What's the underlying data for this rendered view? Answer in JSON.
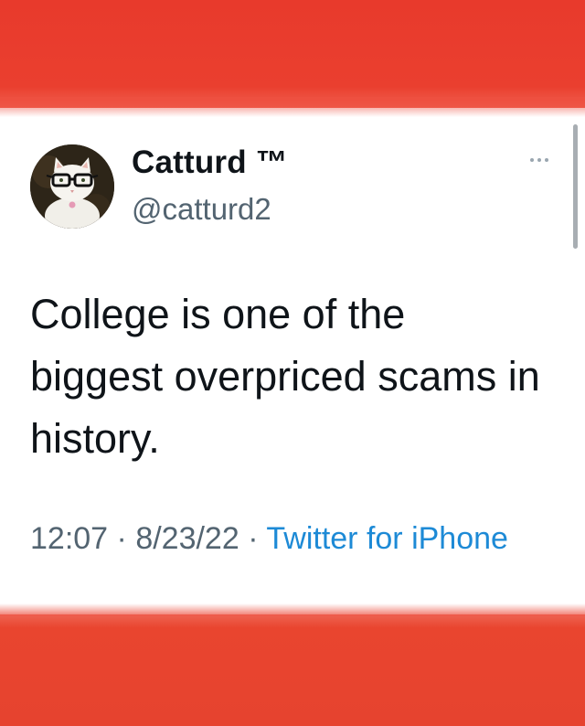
{
  "tweet": {
    "display_name": "Catturd ™",
    "handle": "@catturd2",
    "text": "College is one of the biggest overpriced scams in history.",
    "time": "12:07",
    "separator": " · ",
    "date": "8/23/22",
    "source": "Twitter for iPhone"
  },
  "icons": {
    "more": "more-horizontal-icon",
    "avatar": "cat-with-glasses-avatar"
  },
  "colors": {
    "banner_red": "#e83a2c",
    "link_blue": "#1d8ad6",
    "secondary_text": "#536471"
  }
}
